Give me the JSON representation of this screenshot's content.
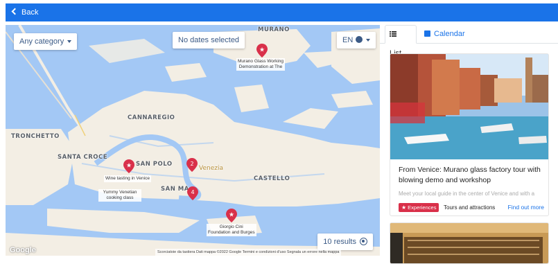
{
  "topbar": {
    "back_label": "Back",
    "color": "#1a73e8"
  },
  "map": {
    "category_filter": "Any category",
    "date_filter": "No dates selected",
    "language": "EN",
    "results_label": "10 results",
    "google_logo": "Google",
    "attribution": "Scorciatoie da tastiera   Dati mappa ©2022 Google   Termini e condizioni d'uso   Segnala un errore nella mappa",
    "places": {
      "murano": "MURANO",
      "cannaregio": "CANNAREGIO",
      "tronchetto": "TRONCHETTO",
      "santa_croce": "SANTA CROCE",
      "san_polo": "SAN POLO",
      "venezia": "Venezia",
      "castello": "CASTELLO",
      "san_marco": "SAN MA"
    },
    "pins": {
      "murano_glass": "Murano Glass Working\nDemonstration at The",
      "wine_tasting": "Wine tasting in Venice",
      "cooking_class": "Yummy Venetian\ncooking class",
      "giorgio_cini": "Giorgio Cini\nFoundation and Burges",
      "cluster_a": "2",
      "cluster_b": "4"
    },
    "pin_color": "#d9304a"
  },
  "panel": {
    "tab_list": "List",
    "tab_calendar": "Calendar",
    "card": {
      "title": "From Venice: Murano glass factory tour with blowing demo and workshop",
      "description": "Meet your local guide in the center of Venice and with a",
      "badge": "Experiences",
      "sub_category": "Tours and attractions",
      "link": "Find out more"
    }
  }
}
